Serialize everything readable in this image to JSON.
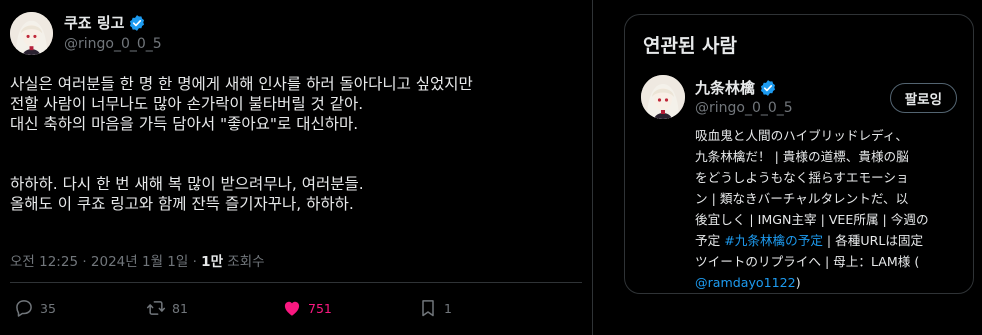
{
  "tweet": {
    "display_name": "쿠죠 링고",
    "handle": "@ringo_0_0_5",
    "body_lines": [
      "사실은 여러분들 한 명 한 명에게 새해 인사를 하러 돌아다니고 싶었지만",
      "전할 사람이 너무나도 많아 손가락이 불타버릴 것 같아.",
      "대신 축하의 마음을 가득 담아서 \"좋아요\"로 대신하마.",
      "하하하. 다시 한 번 새해 복 많이 받으려무나, 여러분들.",
      "올해도 이 쿠죠 링고와 함께 잔뜩 즐기자꾸나, 하하하."
    ],
    "time": "오전 12:25 · 2024년 1월 1일 · ",
    "views_count": "1만",
    "views_label": " 조회수",
    "actions": {
      "reply_count": "35",
      "retweet_count": "81",
      "like_count": "751",
      "bookmark_count": "1"
    }
  },
  "related": {
    "title": "연관된 사람",
    "user": {
      "display_name": "九条林檎",
      "handle": "@ringo_0_0_5",
      "follow_label": "팔로잉",
      "bio_lines": [
        [
          "吸血鬼と人間のハイブリッドレディ、"
        ],
        [
          "九条林檎だ！ | 貴様の道標、貴様の脳"
        ],
        [
          "をどうしようもなく揺らすエモーショ"
        ],
        [
          "ン | 類なきバーチャルタレントだ、以"
        ],
        [
          "後宜しく | IMGN主宰 | VEE所属 | 今週の"
        ],
        [
          "予定 ",
          "#九条林檎の予定",
          " | 各種URLは固定"
        ],
        [
          "ツイートのリプライへ | 母上：LAM様 ("
        ],
        [
          "@ramdayo1122",
          ")"
        ]
      ]
    }
  },
  "colors": {
    "accent": "#1d9bf0",
    "like": "#f91880",
    "muted": "#71767b",
    "text": "#e7e9ea",
    "border": "#2f3336"
  },
  "icons": [
    "verified-badge-icon",
    "reply-icon",
    "retweet-icon",
    "heart-icon",
    "bookmark-icon"
  ]
}
